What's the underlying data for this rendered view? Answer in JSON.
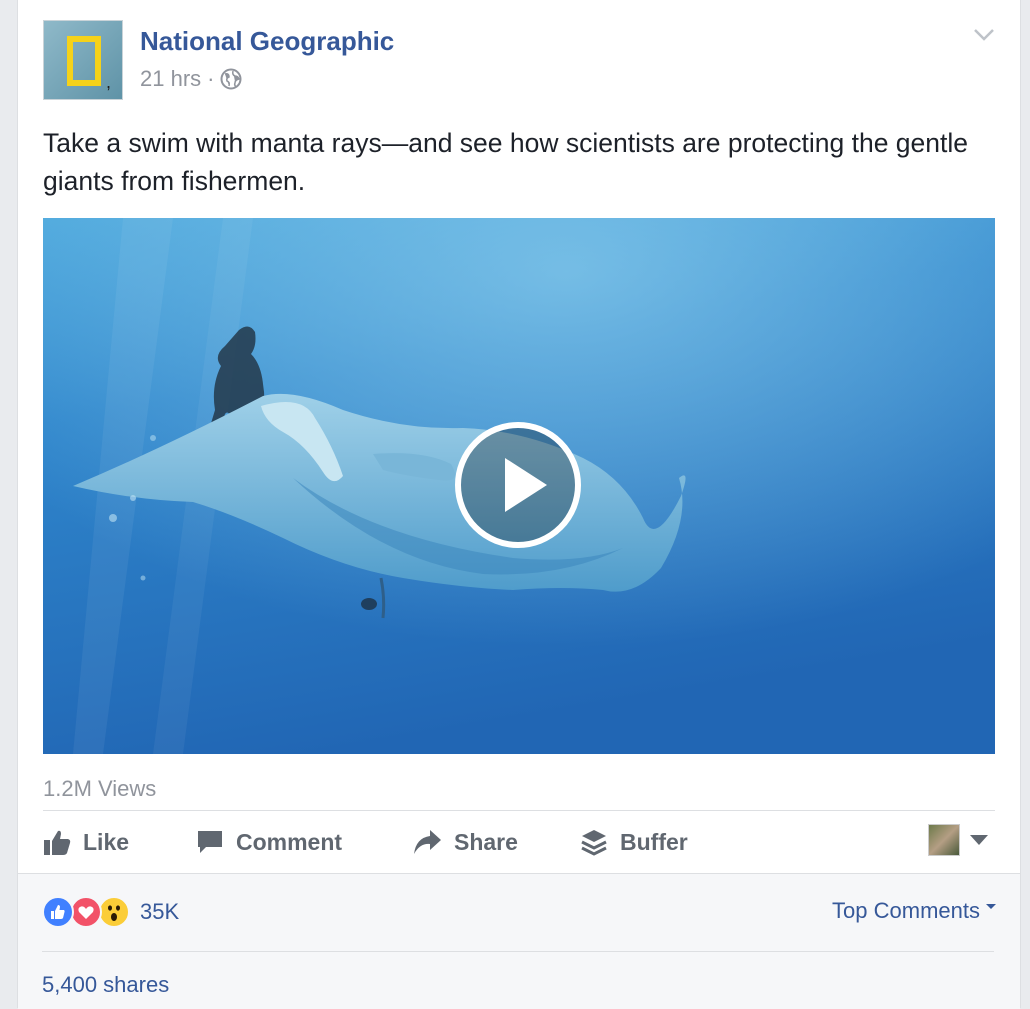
{
  "post": {
    "page_name": "National Geographic",
    "time": "21 hrs",
    "separator": "·",
    "privacy_icon": "globe-icon",
    "text": "Take a swim with manta rays—and see how scientists are protecting the gentle giants from fishermen."
  },
  "video": {
    "views": "1.2M Views",
    "play_icon": "play-icon"
  },
  "actions": {
    "like": "Like",
    "comment": "Comment",
    "share": "Share",
    "buffer": "Buffer"
  },
  "footer": {
    "reaction_icons": [
      "like-icon",
      "love-icon",
      "wow-icon"
    ],
    "reaction_count": "35K",
    "top_comments": "Top Comments",
    "shares": "5,400 shares"
  },
  "colors": {
    "link": "#365899",
    "muted": "#90949c",
    "action": "#606770"
  }
}
